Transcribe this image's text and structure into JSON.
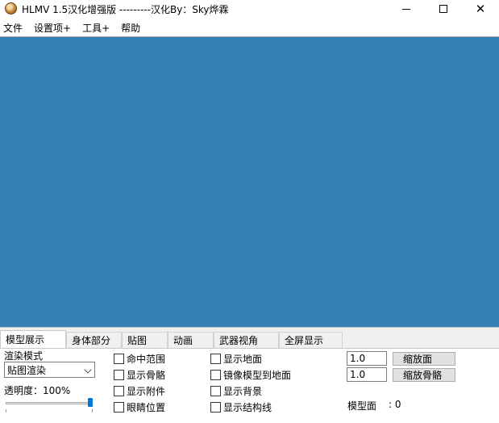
{
  "window": {
    "title": "HLMV 1.5汉化增强版 ---------汉化By：Sky烨霖",
    "icon": "hlmv-app-icon"
  },
  "menu": {
    "items": [
      {
        "label": "文件"
      },
      {
        "label": "设置项+"
      },
      {
        "label": "工具+"
      },
      {
        "label": "帮助"
      }
    ]
  },
  "viewport": {
    "background_color": "#3580b5"
  },
  "tabs": [
    {
      "label": "模型展示",
      "active": true
    },
    {
      "label": "身体部分",
      "active": false
    },
    {
      "label": "贴图",
      "active": false
    },
    {
      "label": "动画",
      "active": false
    },
    {
      "label": "武器视角",
      "active": false
    },
    {
      "label": "全屏显示",
      "active": false
    }
  ],
  "model_display": {
    "render_mode_label": "渲染模式",
    "render_mode_value": "贴图渲染",
    "opacity_label": "透明度：100%",
    "opacity_value": 1.0,
    "checkboxes_col1": [
      "命中范围",
      "显示骨骼",
      "显示附件",
      "眼睛位置"
    ],
    "checkboxes_col2": [
      "显示地面",
      "镜像模型到地面",
      "显示背景",
      "显示结构线"
    ],
    "scale_mesh_value": "1.0",
    "scale_bones_value": "1.0",
    "scale_mesh_button": "缩放面",
    "scale_bones_button": "缩放骨骼",
    "faces_label": "模型面",
    "faces_value": ": 0"
  }
}
